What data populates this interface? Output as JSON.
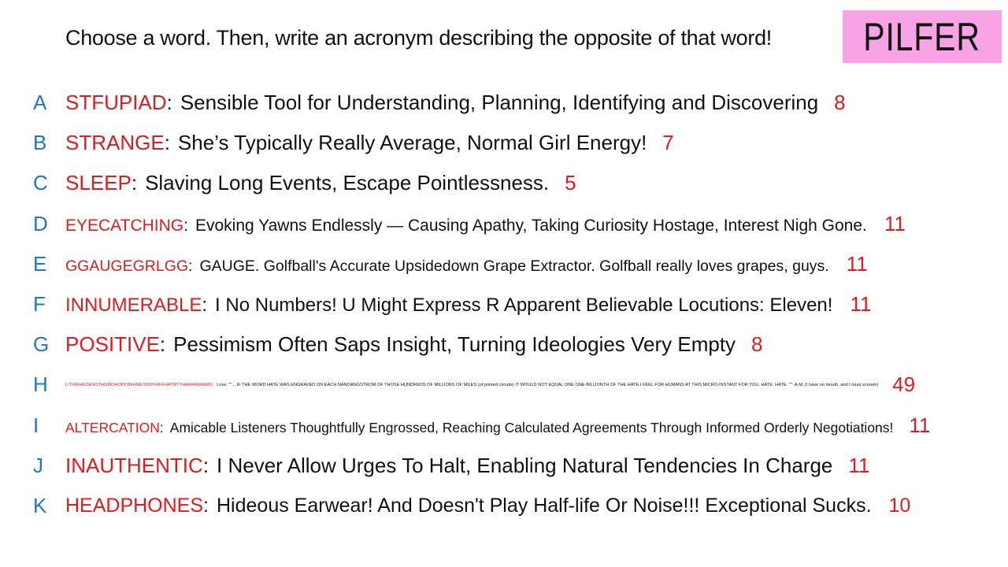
{
  "prompt": "Choose a word. Then, write an acronym describing the opposite of that word!",
  "logo": "PILFER",
  "colors": {
    "logo_background": "#f7a3e6",
    "letter": "#2077c4",
    "word": "#e01b1b",
    "score": "#e01b1b",
    "text": "#111111"
  },
  "entries": [
    {
      "letter": "A",
      "word": "STFUPIAD",
      "definition": "Sensible Tool for Understanding, Planning, Identifying and Discovering",
      "score": "8"
    },
    {
      "letter": "B",
      "word": "STRANGE",
      "definition": "She’s Typically Really Average, Normal Girl Energy!",
      "score": "7"
    },
    {
      "letter": "C",
      "word": "SLEEP",
      "definition": "Slaving Long Events, Escape Pointlessness.",
      "score": "5"
    },
    {
      "letter": "D",
      "word": "EYECATCHING",
      "definition": "Evoking Yawns Endlessly — Causing Apathy, Taking Curiosity Hostage, Interest Nigh Gone.",
      "score": "11"
    },
    {
      "letter": "E",
      "word": "GGAUGEGRLGG",
      "definition": "GAUGE. Golfball's Accurate Upsidedown Grape Extractor. Golfball really loves grapes, guys.",
      "score": "11"
    },
    {
      "letter": "F",
      "word": "INNUMERABLE",
      "definition": "I No Numbers! U Might Express R Apparent Believable Locutions: Eleven!",
      "score": "11"
    },
    {
      "letter": "G",
      "word": "POSITIVE",
      "definition": "Pessimism Often Saps Insight, Turning Ideologies Very Empty",
      "score": "8"
    },
    {
      "letter": "H",
      "word": "LITHWHEOENOTHGMOHOPCIWHNEOODTHIFFHATMTYHHAHNMAIMS",
      "definition": "Love. \"\"... IF THE WORD HATE WAS ENGRAVED ON EACH NANOANGSTROM OF THOSE HUNDREDS OF MILLIONS OF MILES (of printed circuits) IT WOULD NOT EQUAL ONE ONE-BILLIONTH OF THE HATE I FEEL FOR HUMANS AT THIS MICRO-INSTANT FOR YOU. HATE. HATE. \"\" -A.M. (I have no mouth, and I must scream)",
      "score": "49"
    },
    {
      "letter": "I",
      "word": "ALTERCATION",
      "definition": "Amicable Listeners Thoughtfully Engrossed, Reaching Calculated Agreements Through Informed Orderly Negotiations!",
      "score": "11"
    },
    {
      "letter": "J",
      "word": "INAUTHENTIC",
      "definition": "I Never Allow Urges To Halt, Enabling Natural Tendencies In Charge",
      "score": "11"
    },
    {
      "letter": "K",
      "word": "HEADPHONES",
      "definition": "Hideous Earwear! And Doesn't Play Half-life Or Noise!!! Exceptional Sucks.",
      "score": "10"
    }
  ]
}
